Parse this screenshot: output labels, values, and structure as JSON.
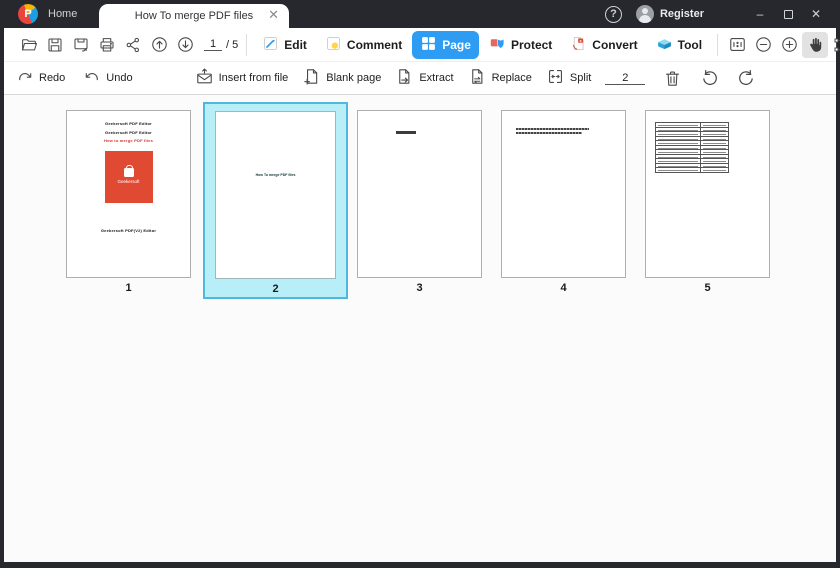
{
  "titlebar": {
    "home_label": "Home",
    "tab_title": "How To merge PDF files",
    "register_label": "Register"
  },
  "toolbar": {
    "page_current": "1",
    "page_total": "/  5",
    "modes": [
      {
        "label": "Edit"
      },
      {
        "label": "Comment"
      },
      {
        "label": "Page",
        "active": true
      },
      {
        "label": "Protect"
      },
      {
        "label": "Convert"
      },
      {
        "label": "Tool"
      }
    ],
    "search_placeholder": ""
  },
  "editbar": {
    "redo_label": "Redo",
    "undo_label": "Undo",
    "insert_label": "Insert from file",
    "blank_label": "Blank page",
    "extract_label": "Extract",
    "replace_label": "Replace",
    "split_label": "Split",
    "split_value": "2"
  },
  "thumbnails": {
    "selected_page": "2",
    "pages": [
      {
        "number": "1",
        "title_line1": "Geekersoft PDF Editor",
        "title_line2": "Geekersoft PDF Editor",
        "red_line": "How to merge PDF files",
        "logo_text": "Geekersoft",
        "footer_line": "Geekersoft PDF(V2) Editor"
      },
      {
        "number": "2",
        "center_text": "How To merge PDF files"
      },
      {
        "number": "3"
      },
      {
        "number": "4"
      },
      {
        "number": "5"
      }
    ]
  },
  "colors": {
    "accent_blue": "#2e9cf2",
    "selection_fill": "#b8eef8",
    "selection_border": "#51b7dd",
    "titlebar_bg": "#26282d",
    "page1_logo_red": "#e04a33"
  }
}
